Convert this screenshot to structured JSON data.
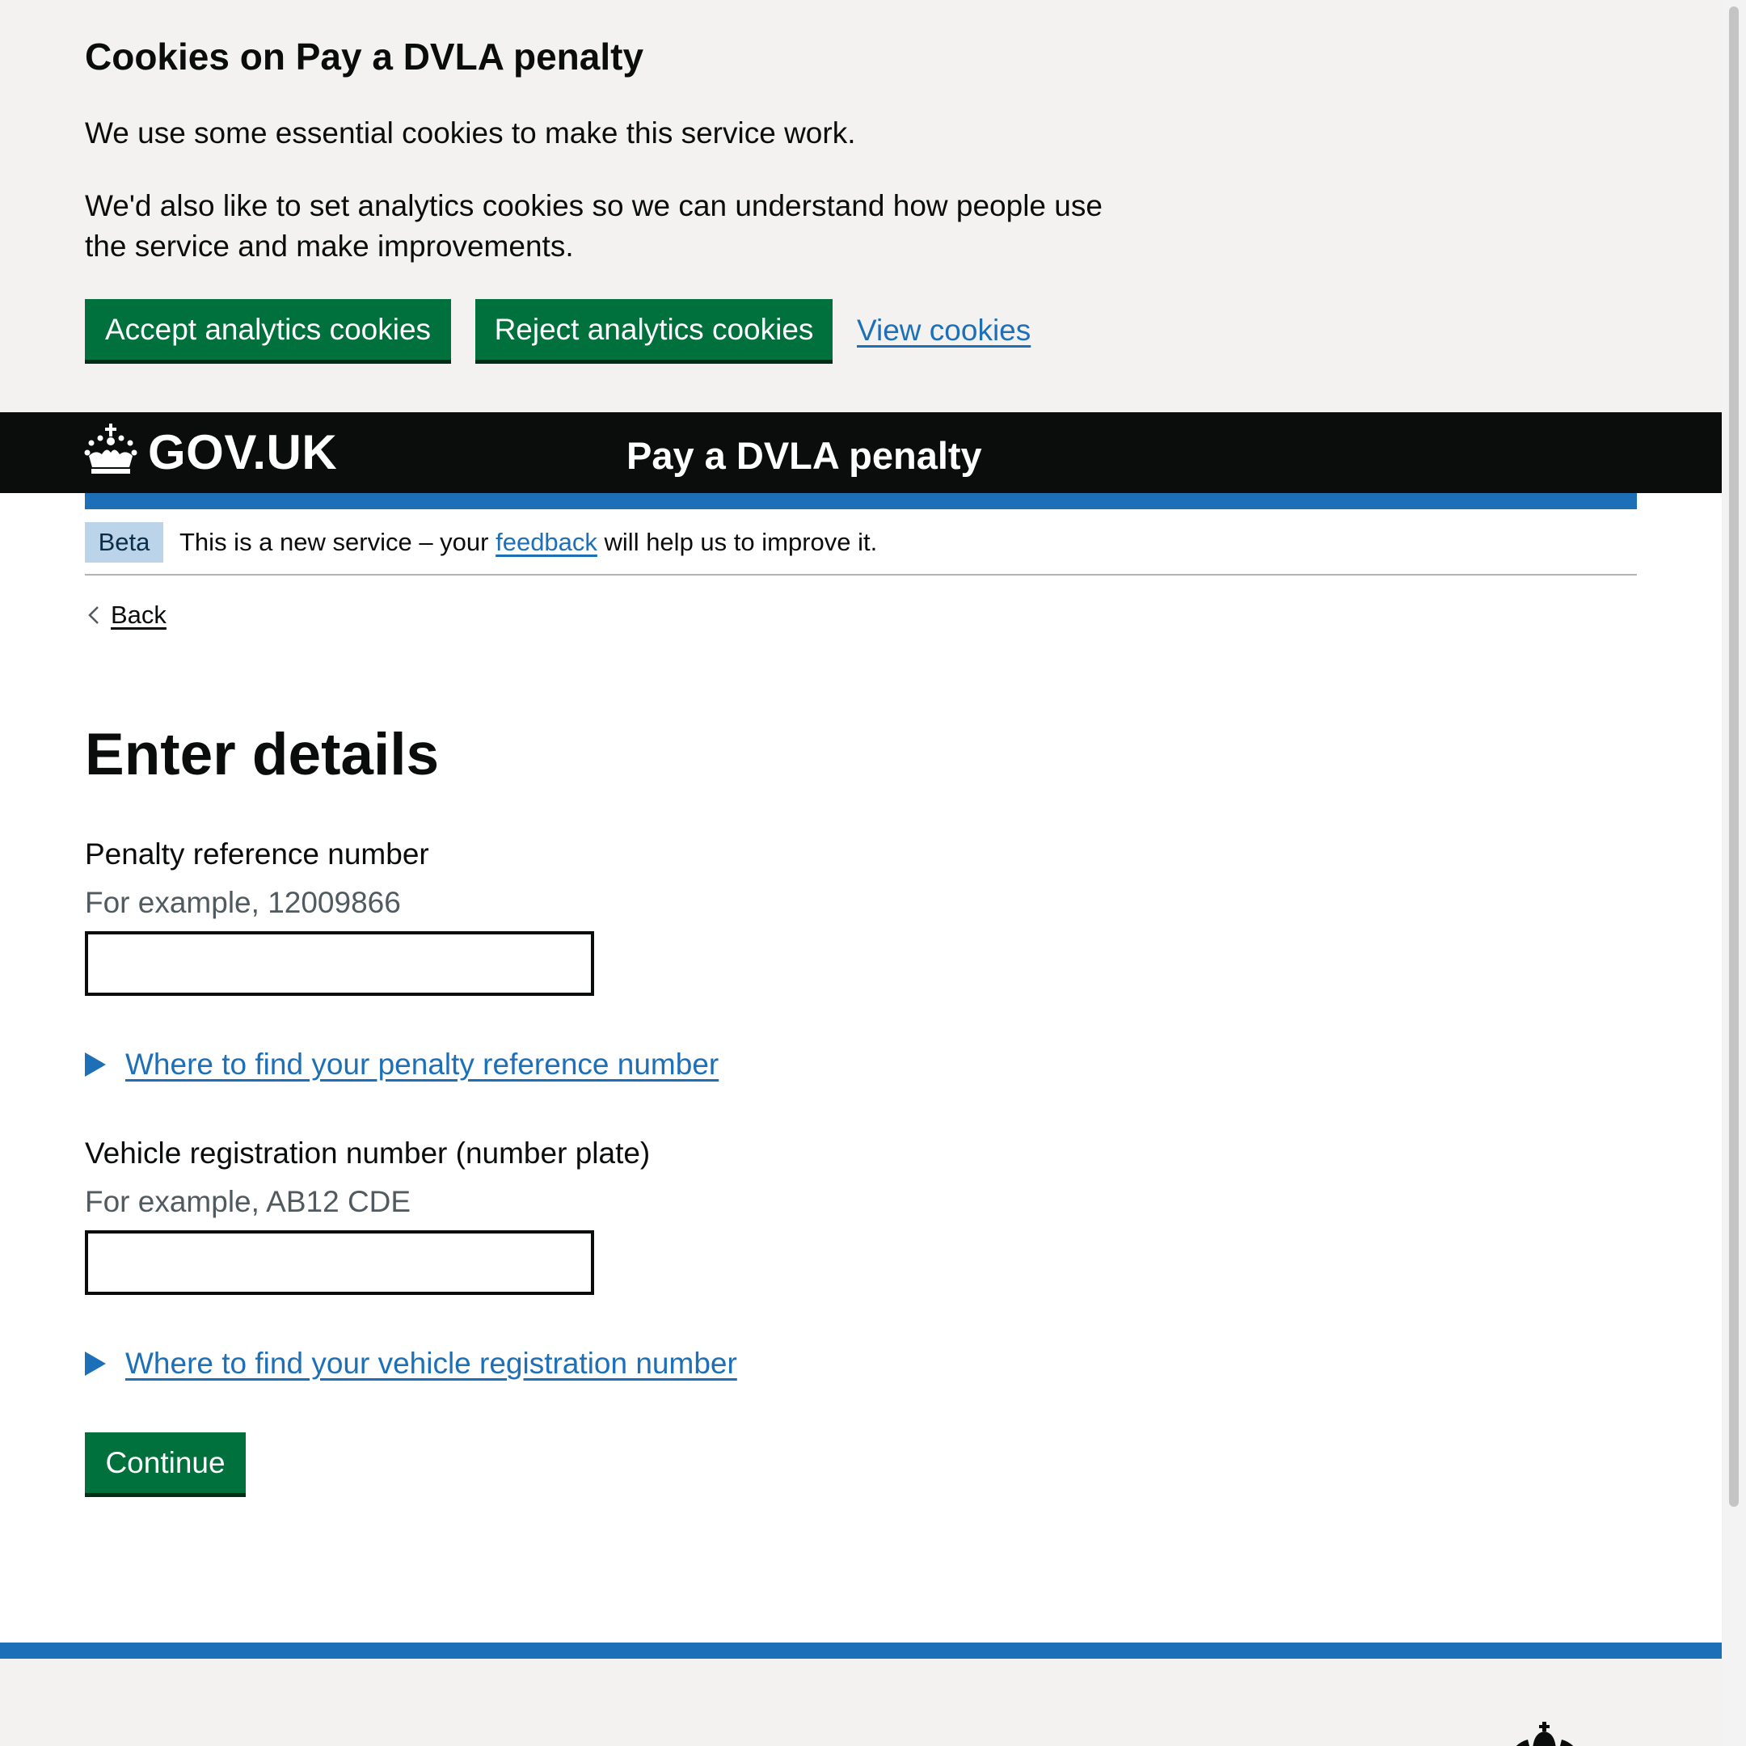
{
  "cookie_banner": {
    "title": "Cookies on Pay a DVLA penalty",
    "paragraph_1": "We use some essential cookies to make this service work.",
    "paragraph_2": "We'd also like to set analytics cookies so we can understand how people use the service and make improvements.",
    "accept_label": "Accept analytics cookies",
    "reject_label": "Reject analytics cookies",
    "view_label": "View cookies"
  },
  "header": {
    "logo_text": "GOV.UK",
    "logo_icon": "crown-icon",
    "service_name": "Pay a DVLA penalty"
  },
  "phase_banner": {
    "tag": "Beta",
    "text_before": "This is a new service – your ",
    "link_text": "feedback",
    "text_after": " will help us to improve it."
  },
  "back_link": {
    "label": "Back",
    "icon": "chevron-left-icon"
  },
  "main": {
    "title": "Enter details",
    "penalty_reference": {
      "label": "Penalty reference number",
      "hint": "For example, 12009866",
      "value": "",
      "details_summary": "Where to find your penalty reference number"
    },
    "vehicle_registration": {
      "label": "Vehicle registration number (number plate)",
      "hint": "For example, AB12 CDE",
      "value": "",
      "details_summary": "Where to find your vehicle registration number"
    },
    "continue_label": "Continue"
  },
  "colors": {
    "button_green": "#00703c",
    "link_blue": "#1d70b8",
    "header_black": "#0b0c0c",
    "banner_grey": "#f3f2f1",
    "beta_tag_bg": "#bbd4ea",
    "hint_grey": "#505a5f"
  }
}
